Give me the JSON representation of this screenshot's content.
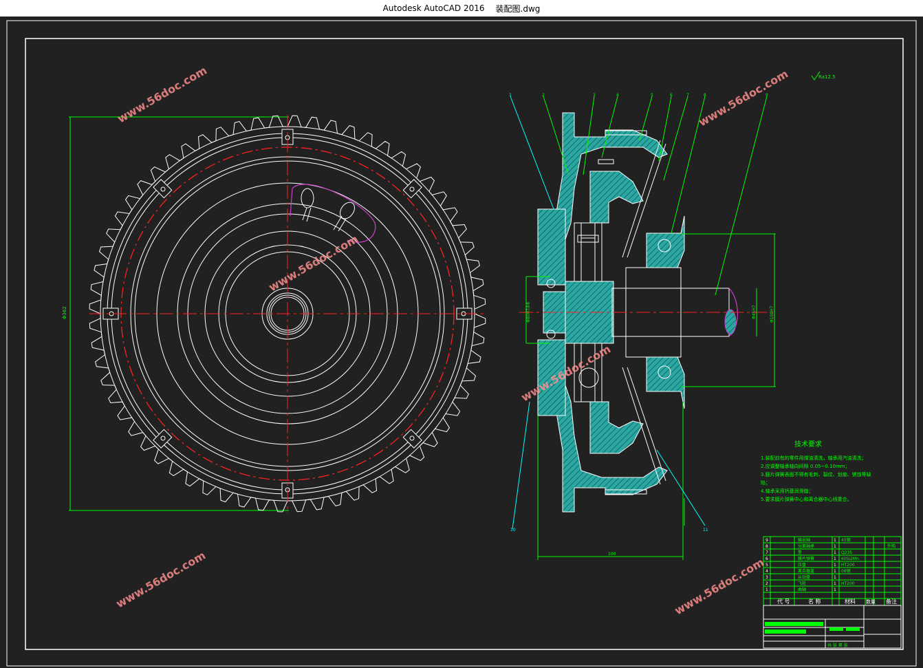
{
  "window": {
    "app_title": "Autodesk AutoCAD 2016",
    "file_name": "装配图.dwg"
  },
  "colors": {
    "background": "#212121",
    "line_white": "#ffffff",
    "center_red": "#ff2020",
    "dimension_green": "#00ff00",
    "leader_cyan": "#00ffff",
    "section_teal": "#2aa7a2",
    "magenta": "#d040d0",
    "watermark": "#ff8f8f"
  },
  "watermark": {
    "text": "www.56doc.com"
  },
  "drawing": {
    "surface_finish": "Ra12.5",
    "front_view_dimension": "Φ362",
    "section_dimensions": {
      "bottom_width": "100",
      "bore_left": "Φ80H7/h6",
      "shaft": "Φ45H7",
      "right_bore": "Φ100H7"
    },
    "balloons": [
      "1",
      "2",
      "3",
      "4",
      "5",
      "6",
      "7",
      "8",
      "9"
    ],
    "balloon_lower": "10",
    "balloon_11": "11"
  },
  "tech_requirements": {
    "title": "技术要求",
    "items": [
      "1.装配前有的零件用煤油清洗，轴承用汽油清洗；",
      "2.应调整轴承轴向间隙 0.05~0.10mm；",
      "3.膜片弹簧表面不得有毛刺、裂纹、划痕、锈蚀等缺",
      "陷；",
      "4.轴承采用钙基润滑脂；",
      "5.要求膜片弹簧中心和离合器中心线重合。"
    ]
  },
  "bom": {
    "header": [
      "代 号",
      "名 称",
      "材料",
      "数量",
      "备注"
    ],
    "rows": [
      [
        "9",
        "",
        "输出轴",
        "1",
        "45钢",
        "",
        ""
      ],
      [
        "8",
        "",
        "分离轴承",
        "1",
        "",
        "",
        "外购"
      ],
      [
        "7",
        "",
        "垫",
        "1",
        "Q235",
        "",
        ""
      ],
      [
        "6",
        "",
        "膜片弹簧",
        "1",
        "60Si2Mn",
        "",
        ""
      ],
      [
        "5",
        "",
        "压盘",
        "1",
        "HT200",
        "",
        ""
      ],
      [
        "4",
        "",
        "离合器盖",
        "1",
        "08钢",
        "",
        ""
      ],
      [
        "3",
        "",
        "从动盘",
        "1",
        "",
        "",
        ""
      ],
      [
        "2",
        "",
        "飞轮",
        "1",
        "HT200",
        "",
        ""
      ],
      [
        "1",
        "",
        "曲轴",
        "1",
        "",
        "",
        ""
      ]
    ],
    "title_block": {
      "scale_label": "比 例",
      "sheet_label": "共 张 第 张"
    }
  }
}
